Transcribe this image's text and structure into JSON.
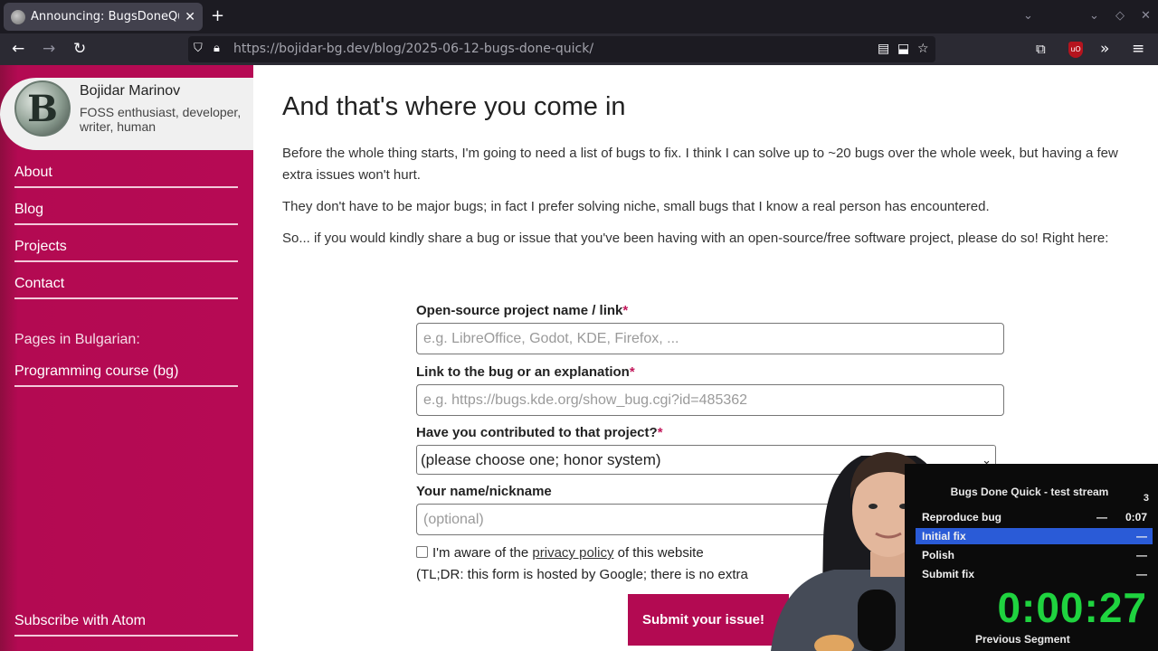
{
  "browser": {
    "tab_title": "Announcing: BugsDoneQuick",
    "tab_close": "✕",
    "new_tab": "+",
    "url_domain": "https://bojidar-bg.dev",
    "url_path": "/blog/2025-06-12-bugs-done-quick/"
  },
  "sidebar": {
    "name": "Bojidar Marinov",
    "avatar_letter": "B",
    "description": "FOSS enthusiast, developer, writer, human",
    "links": [
      "About",
      "Blog",
      "Projects",
      "Contact"
    ],
    "bulgarian_label": "Pages in Bulgarian:",
    "bulgarian_link": "Programming course (bg)",
    "subscribe": "Subscribe with Atom"
  },
  "article": {
    "heading": "And that's where you come in",
    "paragraphs": [
      "Before the whole thing starts, I'm going to need a list of bugs to fix. I think I can solve up to ~20 bugs over the whole week, but having a few extra issues won't hurt.",
      "They don't have to be major bugs; in fact I prefer solving niche, small bugs that I know a real person has encountered.",
      "So... if you would kindly share a bug or issue that you've been having with an open-source/free software project, please do so! Right here:"
    ]
  },
  "form": {
    "project_label": "Open-source project name / link",
    "project_placeholder": "e.g. LibreOffice, Godot, KDE, Firefox, ...",
    "bug_label": "Link to the bug or an explanation",
    "bug_placeholder": "e.g. https://bugs.kde.org/show_bug.cgi?id=485362",
    "contributed_label": "Have you contributed to that project?",
    "contributed_selected": "(please choose one; honor system)",
    "name_label": "Your name/nickname",
    "name_placeholder": "(optional)",
    "required_mark": "*",
    "privacy_before": "I'm aware of the ",
    "privacy_link": "privacy policy",
    "privacy_after": " of this website",
    "tldr": "(TL;DR: this form is hosted by Google; there is no extra",
    "submit": "Submit your issue!"
  },
  "timer": {
    "title": "Bugs Done Quick - test stream",
    "attempts": "3",
    "splits": [
      {
        "name": "Reproduce bug",
        "delta": "—",
        "time": "0:07",
        "active": false
      },
      {
        "name": "Initial fix",
        "delta": "",
        "time": "—",
        "active": true
      },
      {
        "name": "Polish",
        "delta": "",
        "time": "—",
        "active": false
      },
      {
        "name": "Submit fix",
        "delta": "",
        "time": "—",
        "active": false
      }
    ],
    "current_time": "0:00:27",
    "previous_segment": "Previous Segment"
  }
}
